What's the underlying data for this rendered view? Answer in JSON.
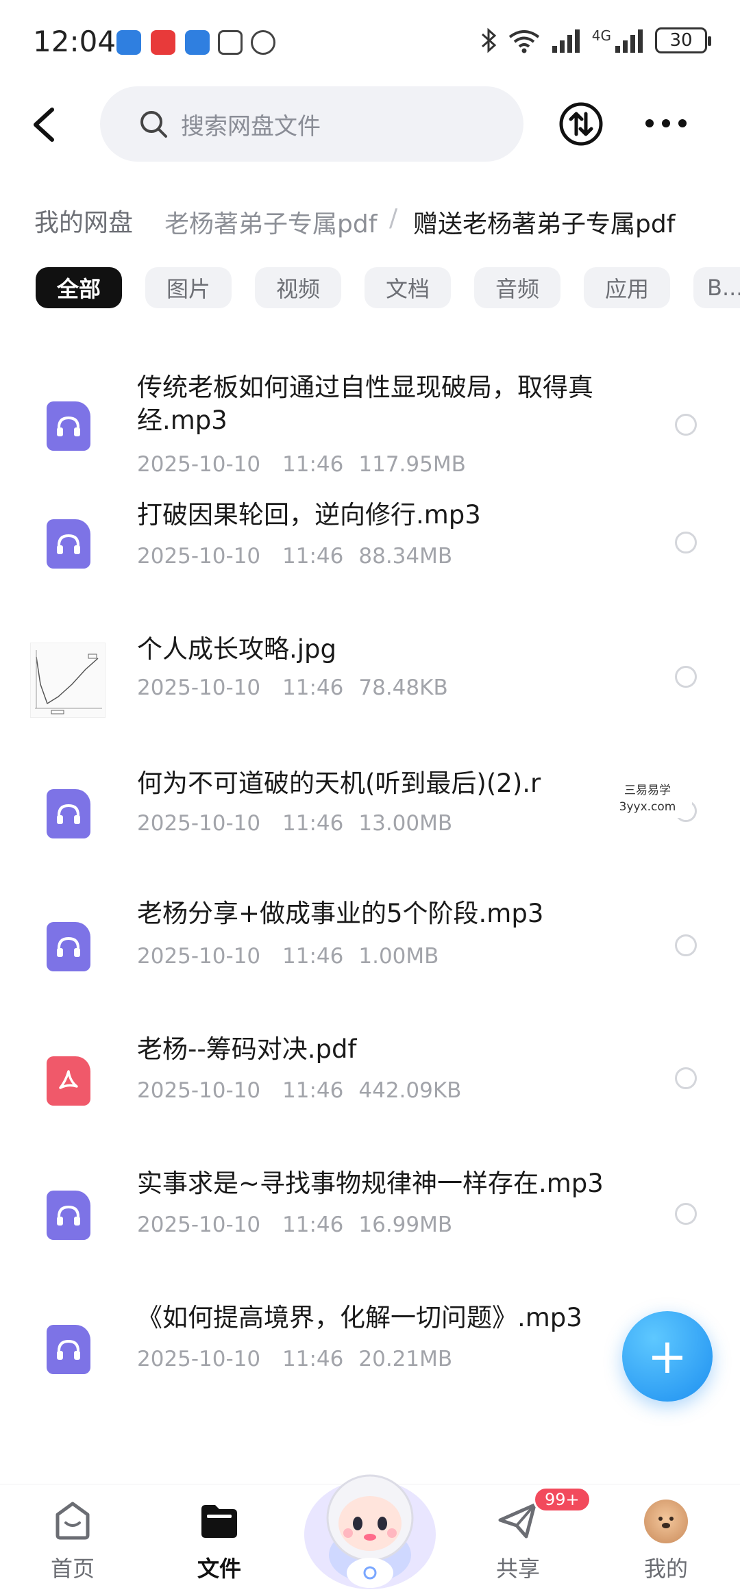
{
  "status_bar": {
    "time": "12:04",
    "battery": "30",
    "network_label": "4G"
  },
  "header": {
    "search_placeholder": "搜索网盘文件"
  },
  "breadcrumb": {
    "root": "我的网盘",
    "middle": "老杨著弟子专属pdf",
    "separator": "/",
    "current": "赠送老杨著弟子专属pdf"
  },
  "filters": [
    {
      "label": "全部",
      "active": true
    },
    {
      "label": "图片"
    },
    {
      "label": "视频"
    },
    {
      "label": "文档"
    },
    {
      "label": "音频"
    },
    {
      "label": "应用"
    },
    {
      "label": "B..."
    }
  ],
  "files": [
    {
      "name": "传统老板如何通过自性显现破局，取得真经.mp3",
      "date": "2025-10-10",
      "time": "11:46",
      "size": "117.95MB",
      "type": "audio",
      "icon": "headphones-icon"
    },
    {
      "name": "打破因果轮回，逆向修行.mp3",
      "date": "2025-10-10",
      "time": "11:46",
      "size": "88.34MB",
      "type": "audio",
      "icon": "headphones-icon"
    },
    {
      "name": "个人成长攻略.jpg",
      "date": "2025-10-10",
      "time": "11:46",
      "size": "78.48KB",
      "type": "image",
      "icon": "image-thumbnail"
    },
    {
      "name": "何为不可道破的天机(听到最后)(2).r",
      "date": "2025-10-10",
      "time": "11:46",
      "size": "13.00MB",
      "type": "audio",
      "icon": "headphones-icon"
    },
    {
      "name": "老杨分享+做成事业的5个阶段.mp3",
      "date": "2025-10-10",
      "time": "11:46",
      "size": "1.00MB",
      "type": "audio",
      "icon": "headphones-icon"
    },
    {
      "name": "老杨--筹码对决.pdf",
      "date": "2025-10-10",
      "time": "11:46",
      "size": "442.09KB",
      "type": "pdf",
      "icon": "pdf-icon"
    },
    {
      "name": "实事求是~寻找事物规律神一样存在.mp3",
      "date": "2025-10-10",
      "time": "11:46",
      "size": "16.99MB",
      "type": "audio",
      "icon": "headphones-icon"
    },
    {
      "name": "《如何提高境界，化解一切问题》.mp3",
      "date": "2025-10-10",
      "time": "11:46",
      "size": "20.21MB",
      "type": "audio",
      "icon": "headphones-icon"
    }
  ],
  "watermark": {
    "line1": "三易易学",
    "line2": "3yyx.com"
  },
  "fab": {
    "label": "+"
  },
  "bottom_nav": {
    "home": "首页",
    "files": "文件",
    "share": "共享",
    "share_badge": "99+",
    "me": "我的"
  },
  "colors": {
    "audio_icon": "#7d73e6",
    "pdf_icon": "#f0596a",
    "fab": "#1d8ff0",
    "badge": "#f24a5c"
  }
}
